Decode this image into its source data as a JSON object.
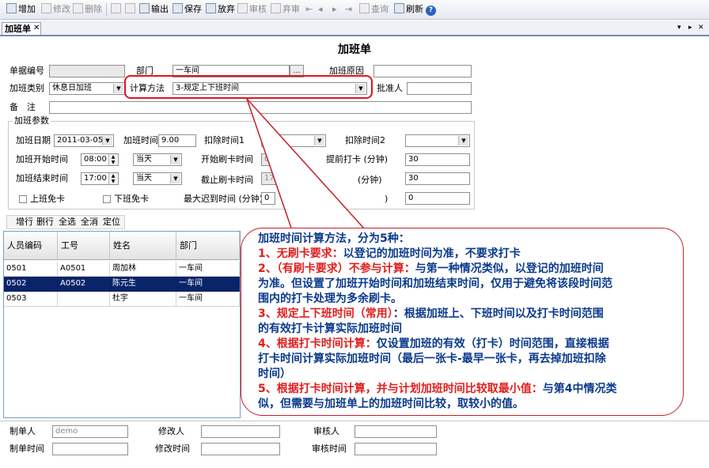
{
  "toolbar": {
    "add": "增加",
    "edit": "修改",
    "delete": "删除",
    "export": "输出",
    "save": "保存",
    "discard": "放弃",
    "audit": "审核",
    "unaudit": "弃审",
    "query": "查询",
    "refresh": "刷新"
  },
  "tab": {
    "label": "加班单",
    "close": "✕"
  },
  "form": {
    "title": "加班单",
    "doc_no_label": "单据编号",
    "doc_no_value": "",
    "dept_label": "部门",
    "dept_value": "一车间",
    "reason_label": "加班原因",
    "reason_value": "",
    "type_label": "加班类别",
    "type_value": "休息日加班",
    "calc_label": "计算方法",
    "calc_value": "3-规定上下班时间",
    "approver_label": "批准人",
    "approver_value": "",
    "remark_label": "备　注",
    "remark_value": ""
  },
  "params": {
    "group_title": "加班参数",
    "date_label": "加班日期",
    "date_value": "2011-03-05",
    "hours_label": "加班时间",
    "hours_value": "9.00",
    "deduct1_label": "扣除时间1",
    "deduct1_value": "",
    "deduct2_label": "扣除时间2",
    "deduct2_value": "",
    "start_label": "加班开始时间",
    "start_value": "08:00",
    "start_day": "当天",
    "start_card_label": "开始刷卡时间",
    "start_card_value": "07:",
    "advance_label": "提前打卡 (分钟)",
    "advance_value": "30",
    "end_label": "加班结束时间",
    "end_value": "17:00",
    "end_day": "当天",
    "end_card_label": "截止刷卡时间",
    "end_card_value": "17:30",
    "delay_label": "(分钟)",
    "delay_value": "30",
    "on_exempt_label": "上班免卡",
    "off_exempt_label": "下班免卡",
    "max_late_label": "最大迟到时间 (分钟)",
    "max_late_value": "0",
    "other_label": ")",
    "other_value": "0"
  },
  "grid_toolbar": {
    "add_row": "增行",
    "del_row": "删行",
    "select_all": "全选",
    "deselect_all": "全消",
    "locate": "定位"
  },
  "grid": {
    "headers": [
      "人员编码",
      "工号",
      "姓名",
      "部门"
    ],
    "rows": [
      [
        "0501",
        "A0501",
        "周加林",
        "一车间"
      ],
      [
        "0502",
        "A0502",
        "陈元生",
        "一车间"
      ],
      [
        "0503",
        "",
        "杜宇",
        "一车间"
      ]
    ]
  },
  "callout": {
    "l1": "加班时间计算方法，分为5种：",
    "l2a": "1、无刷卡要求：",
    "l2b": "以登记的加班时间为准，不要求打卡",
    "l3a": "2、（有刷卡要求）不参与计算：",
    "l3b": "与第一种情况类似，以登记的加班时间",
    "l4": "为准。但设置了加班开始时间和加班结束时间，仅用于避免将该段时间范",
    "l5": "围内的打卡处理为多余刷卡。",
    "l6a": "3、规定上下班时间（常用）",
    "l6b": "：根据加班上、下班时间以及打卡时间范围",
    "l7": "的有效打卡计算实际加班时间",
    "l8a": "4、根据打卡时间计算：",
    "l8b": "仅设置加班的有效（打卡）时间范围，直接根据",
    "l9": "打卡时间计算实际加班时间（最后一张卡-最早一张卡，再去掉加班扣除",
    "l10": "时间）",
    "l11a": "5、根据打卡时间计算，并与计划加班时间比较取最小值：",
    "l11b": "与第4中情况类",
    "l12": "似，但需要与加班单上的加班时间比较，取较小的值。"
  },
  "footer": {
    "creator_label": "制单人",
    "creator_value": "demo",
    "modifier_label": "修改人",
    "modifier_value": "",
    "auditor_label": "审核人",
    "auditor_value": "",
    "create_time_label": "制单时间",
    "create_time_value": "",
    "modify_time_label": "修改时间",
    "modify_time_value": "",
    "audit_time_label": "审核时间",
    "audit_time_value": ""
  }
}
